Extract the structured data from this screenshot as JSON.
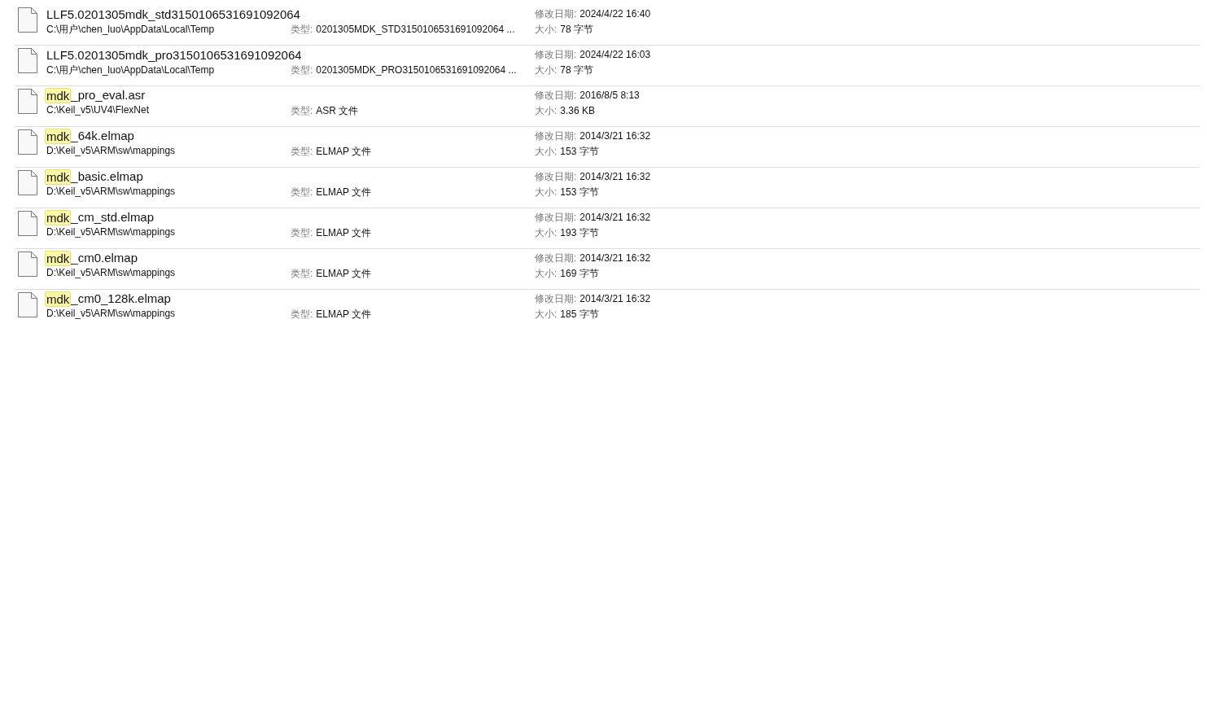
{
  "results": [
    {
      "name": "LLF5.0201305mdk_std3150106531691092064",
      "path": "C:\\用户\\chen_luo\\AppData\\Local\\Temp",
      "type_label": "类型:",
      "type": "0201305MDK_STD3150106531691092064 ...",
      "date_label": "修改日期:",
      "date": "2024/4/22 16:40",
      "size_label": "大小:",
      "size": "78 字节"
    },
    {
      "name": "LLF5.0201305mdk_pro3150106531691092064",
      "path": "C:\\用户\\chen_luo\\AppData\\Local\\Temp",
      "type_label": "类型:",
      "type": "0201305MDK_PRO3150106531691092064 ...",
      "date_label": "修改日期:",
      "date": "2024/4/22 16:03",
      "size_label": "大小:",
      "size": "78 字节"
    },
    {
      "name_match": "mdk",
      "name": "_pro_eval.asr",
      "path": "C:\\Keil_v5\\UV4\\FlexNet",
      "type_label": "类型:",
      "type": "ASR 文件",
      "date_label": "修改日期:",
      "date": "2016/8/5 8:13",
      "size_label": "大小:",
      "size": "3.36 KB"
    },
    {
      "name_match": "mdk",
      "name": "_64k.elmap",
      "path": "D:\\Keil_v5\\ARM\\sw\\mappings",
      "type_label": "类型:",
      "type": "ELMAP 文件",
      "date_label": "修改日期:",
      "date": "2014/3/21 16:32",
      "size_label": "大小:",
      "size": "153 字节"
    },
    {
      "name_match": "mdk",
      "name": "_basic.elmap",
      "path": "D:\\Keil_v5\\ARM\\sw\\mappings",
      "type_label": "类型:",
      "type": "ELMAP 文件",
      "date_label": "修改日期:",
      "date": "2014/3/21 16:32",
      "size_label": "大小:",
      "size": "153 字节"
    },
    {
      "name_match": "mdk",
      "name": "_cm_std.elmap",
      "path": "D:\\Keil_v5\\ARM\\sw\\mappings",
      "type_label": "类型:",
      "type": "ELMAP 文件",
      "date_label": "修改日期:",
      "date": "2014/3/21 16:32",
      "size_label": "大小:",
      "size": "193 字节"
    },
    {
      "name_match": "mdk",
      "name": "_cm0.elmap",
      "path": "D:\\Keil_v5\\ARM\\sw\\mappings",
      "type_label": "类型:",
      "type": "ELMAP 文件",
      "date_label": "修改日期:",
      "date": "2014/3/21 16:32",
      "size_label": "大小:",
      "size": "169 字节"
    },
    {
      "name_match": "mdk",
      "name": "_cm0_128k.elmap",
      "path": "D:\\Keil_v5\\ARM\\sw\\mappings",
      "type_label": "类型:",
      "type": "ELMAP 文件",
      "date_label": "修改日期:",
      "date": "2014/3/21 16:32",
      "size_label": "大小:",
      "size": "185 字节"
    }
  ]
}
